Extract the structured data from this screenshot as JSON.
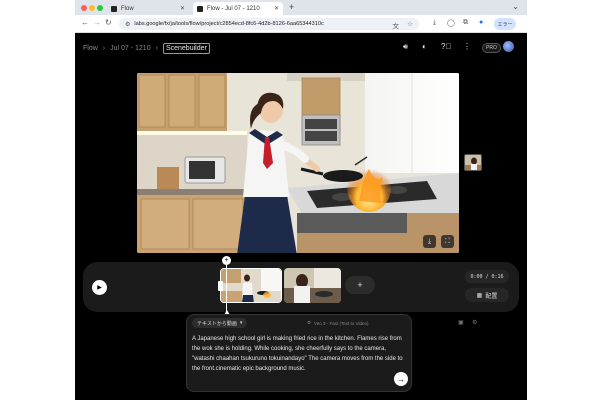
{
  "browser": {
    "tabs": [
      {
        "label": "Flow",
        "active": false
      },
      {
        "label": "Flow - Jul 07 - 1210",
        "active": true
      }
    ],
    "url": "labs.google/fx/ja/tools/flow/project/c2854ecd-8fc6-4d2b-8126-6aa65344310c",
    "profile_label": "エラー"
  },
  "app": {
    "breadcrumb": [
      "Flow",
      "Jul 07 - 1210",
      "Scenebuilder"
    ],
    "plan_badge": "PRO"
  },
  "timeline": {
    "timecode": "0:00 / 0:16",
    "arrange_label": "配置",
    "add_symbol": "+"
  },
  "prompt": {
    "mode": "テキストから動画",
    "model": "Veo 3 - Fast (Text to Video)",
    "text": "A Japanese high school girl is making fried rice in the kitchen. Flames rise from the wok she is holding. While cooking, she cheerfully says to the camera, \"watashi chaahan tsukuruno tokuinandayo\" The camera moves from the side to the front.cinematic epic background music."
  },
  "icons": [
    "volume-icon",
    "discord-icon",
    "help-icon",
    "more-icon",
    "download-icon",
    "fullscreen-icon",
    "play-icon",
    "send-icon"
  ],
  "colors": {
    "accent": "#6aa0ff",
    "flame": "#ff9a1f",
    "uniform_navy": "#1d2a4a"
  }
}
